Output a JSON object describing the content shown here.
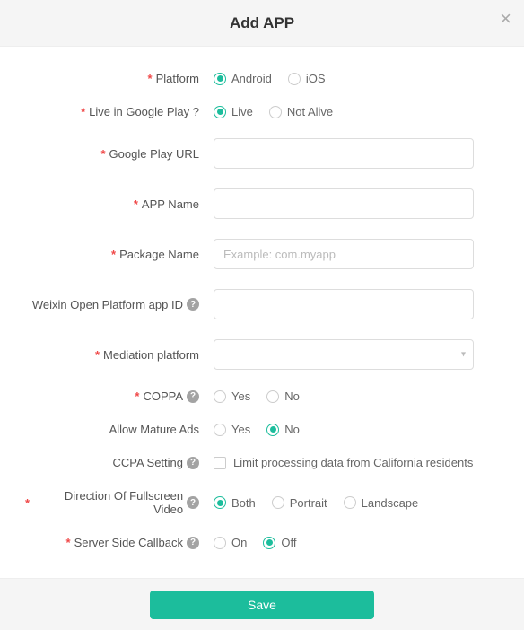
{
  "header": {
    "title": "Add APP"
  },
  "fields": {
    "platform": {
      "label": "Platform",
      "options": {
        "android": "Android",
        "ios": "iOS"
      }
    },
    "liveInGoogle": {
      "label": "Live in Google Play ?",
      "options": {
        "live": "Live",
        "notAlive": "Not Alive"
      }
    },
    "googlePlayUrl": {
      "label": "Google Play URL",
      "value": ""
    },
    "appName": {
      "label": "APP Name",
      "value": ""
    },
    "packageName": {
      "label": "Package Name",
      "placeholder": "Example: com.myapp",
      "value": ""
    },
    "weixinId": {
      "label": "Weixin Open Platform app ID",
      "value": ""
    },
    "mediation": {
      "label": "Mediation platform",
      "value": ""
    },
    "coppa": {
      "label": "COPPA",
      "options": {
        "yes": "Yes",
        "no": "No"
      }
    },
    "matureAds": {
      "label": "Allow Mature Ads",
      "options": {
        "yes": "Yes",
        "no": "No"
      }
    },
    "ccpa": {
      "label": "CCPA Setting",
      "checkboxLabel": "Limit processing data from California residents"
    },
    "direction": {
      "label": "Direction Of Fullscreen Video",
      "options": {
        "both": "Both",
        "portrait": "Portrait",
        "landscape": "Landscape"
      }
    },
    "callback": {
      "label": "Server Side Callback",
      "options": {
        "on": "On",
        "off": "Off"
      }
    }
  },
  "footer": {
    "saveLabel": "Save"
  }
}
